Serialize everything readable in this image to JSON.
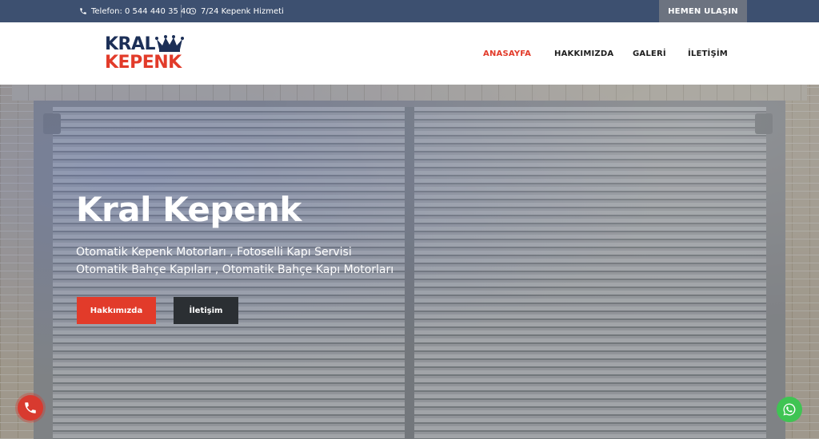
{
  "topbar": {
    "phone_text": "Telefon: 0 544 440 35 40",
    "service_text": "7/24 Kepenk Hizmeti",
    "cta_label": "HEMEN ULAŞIN",
    "icons": {
      "phone": "phone-icon",
      "clock": "clock-icon"
    }
  },
  "logo": {
    "line1": "KRAL",
    "line2": "KEPENK",
    "crown": "crown-icon"
  },
  "nav": [
    {
      "label": "ANASAYFA"
    },
    {
      "label": "HAKKIMIZDA"
    },
    {
      "label": "GALERİ"
    },
    {
      "label": "İLETİŞİM"
    }
  ],
  "hero": {
    "title": "Kral Kepenk",
    "line1": "Otomatik Kepenk Motorları , Fotoselli Kapı Servisi",
    "line2": "Otomatik Bahçe Kapıları , Otomatik Bahçe Kapı Motorları",
    "button_about": "Hakkımızda",
    "button_contact": "İletişim"
  },
  "floating": {
    "call": "phone-call-icon",
    "whatsapp": "whatsapp-icon"
  },
  "colors": {
    "topbar": "#3d5070",
    "accent": "#e23b2a",
    "navy": "#1c2f57",
    "dark_button": "#2b2f33",
    "whatsapp": "#3fc453"
  }
}
